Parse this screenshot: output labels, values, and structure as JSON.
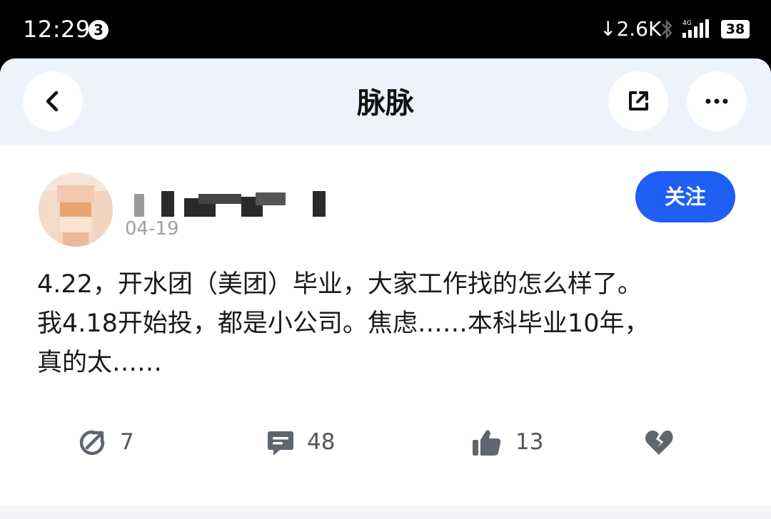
{
  "status_bar": {
    "time": "12:29",
    "notification_count": "3",
    "net_speed": "↓2.6K",
    "network_type": "4G",
    "battery": "38"
  },
  "nav": {
    "title": "脉脉",
    "icons": {
      "back": "chevron-left-icon",
      "share": "share-external-icon",
      "more": "more-horizontal-icon"
    }
  },
  "post": {
    "date": "04-19",
    "follow_label": "关注",
    "text_lines": [
      "4.22，开水团（美团）毕业，大家工作找的怎么样了。",
      "我4.18开始投，都是小公司。焦虑……本科毕业10年，",
      "真的太……"
    ],
    "actions": {
      "share_count": "7",
      "comment_count": "48",
      "like_count": "13"
    }
  },
  "colors": {
    "accent": "#1f5ff4",
    "nav_background": "#eef3fb",
    "text_primary": "#1a1a1a",
    "text_secondary": "#9aa0a8"
  }
}
